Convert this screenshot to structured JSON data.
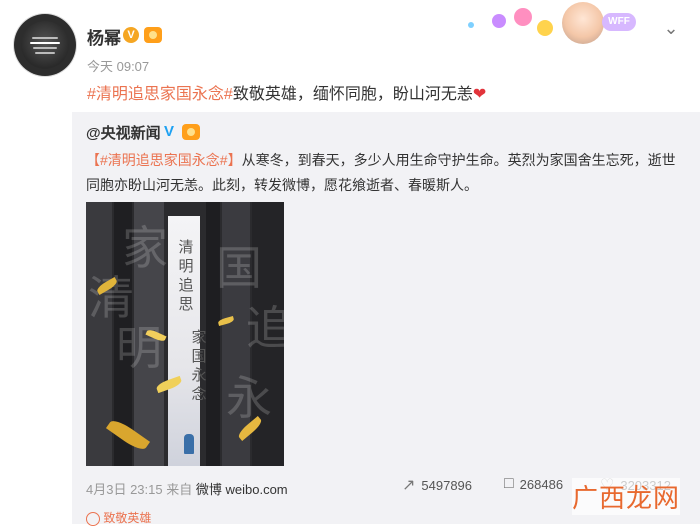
{
  "author": {
    "name": "杨幂",
    "verified_icon": "v-badge",
    "vip_icon": "vip-badge"
  },
  "post": {
    "time": "今天 09:07",
    "hashtag": "#清明追思家国永念#",
    "text": "致敬英雄，缅怀同胞，盼山河无恙",
    "emoji": "❤"
  },
  "repost": {
    "author": "@央视新闻",
    "verified_icon": "blue-v-badge",
    "hashtag": "【#清明追思家国永念#】",
    "body": "从寒冬，到春天，多少人用生命守护生命。英烈为家国舍生忘死，逝世同胞亦盼山河无恙。此刻，转发微博，愿花飨逝者、春暖斯人。",
    "image": {
      "title_line1": "清明追思",
      "title_line2": "家国永念",
      "bg_chars": [
        "清",
        "明",
        "追",
        "思",
        "家",
        "国",
        "永",
        "念"
      ]
    },
    "date": "4月3日 23:15",
    "source_prefix": "来自",
    "source": "微博 weibo.com",
    "share_count": "5497896",
    "comment_count": "268486",
    "like_count": "3203312"
  },
  "decoration": {
    "badge": "WFF"
  },
  "watermark": "广西龙网",
  "sub_tag": "致敬英雄",
  "accent_color": "#eb7350",
  "icons": {
    "menu": "chevron-down-icon",
    "share": "share-icon",
    "comment": "comment-icon",
    "like": "like-icon"
  }
}
